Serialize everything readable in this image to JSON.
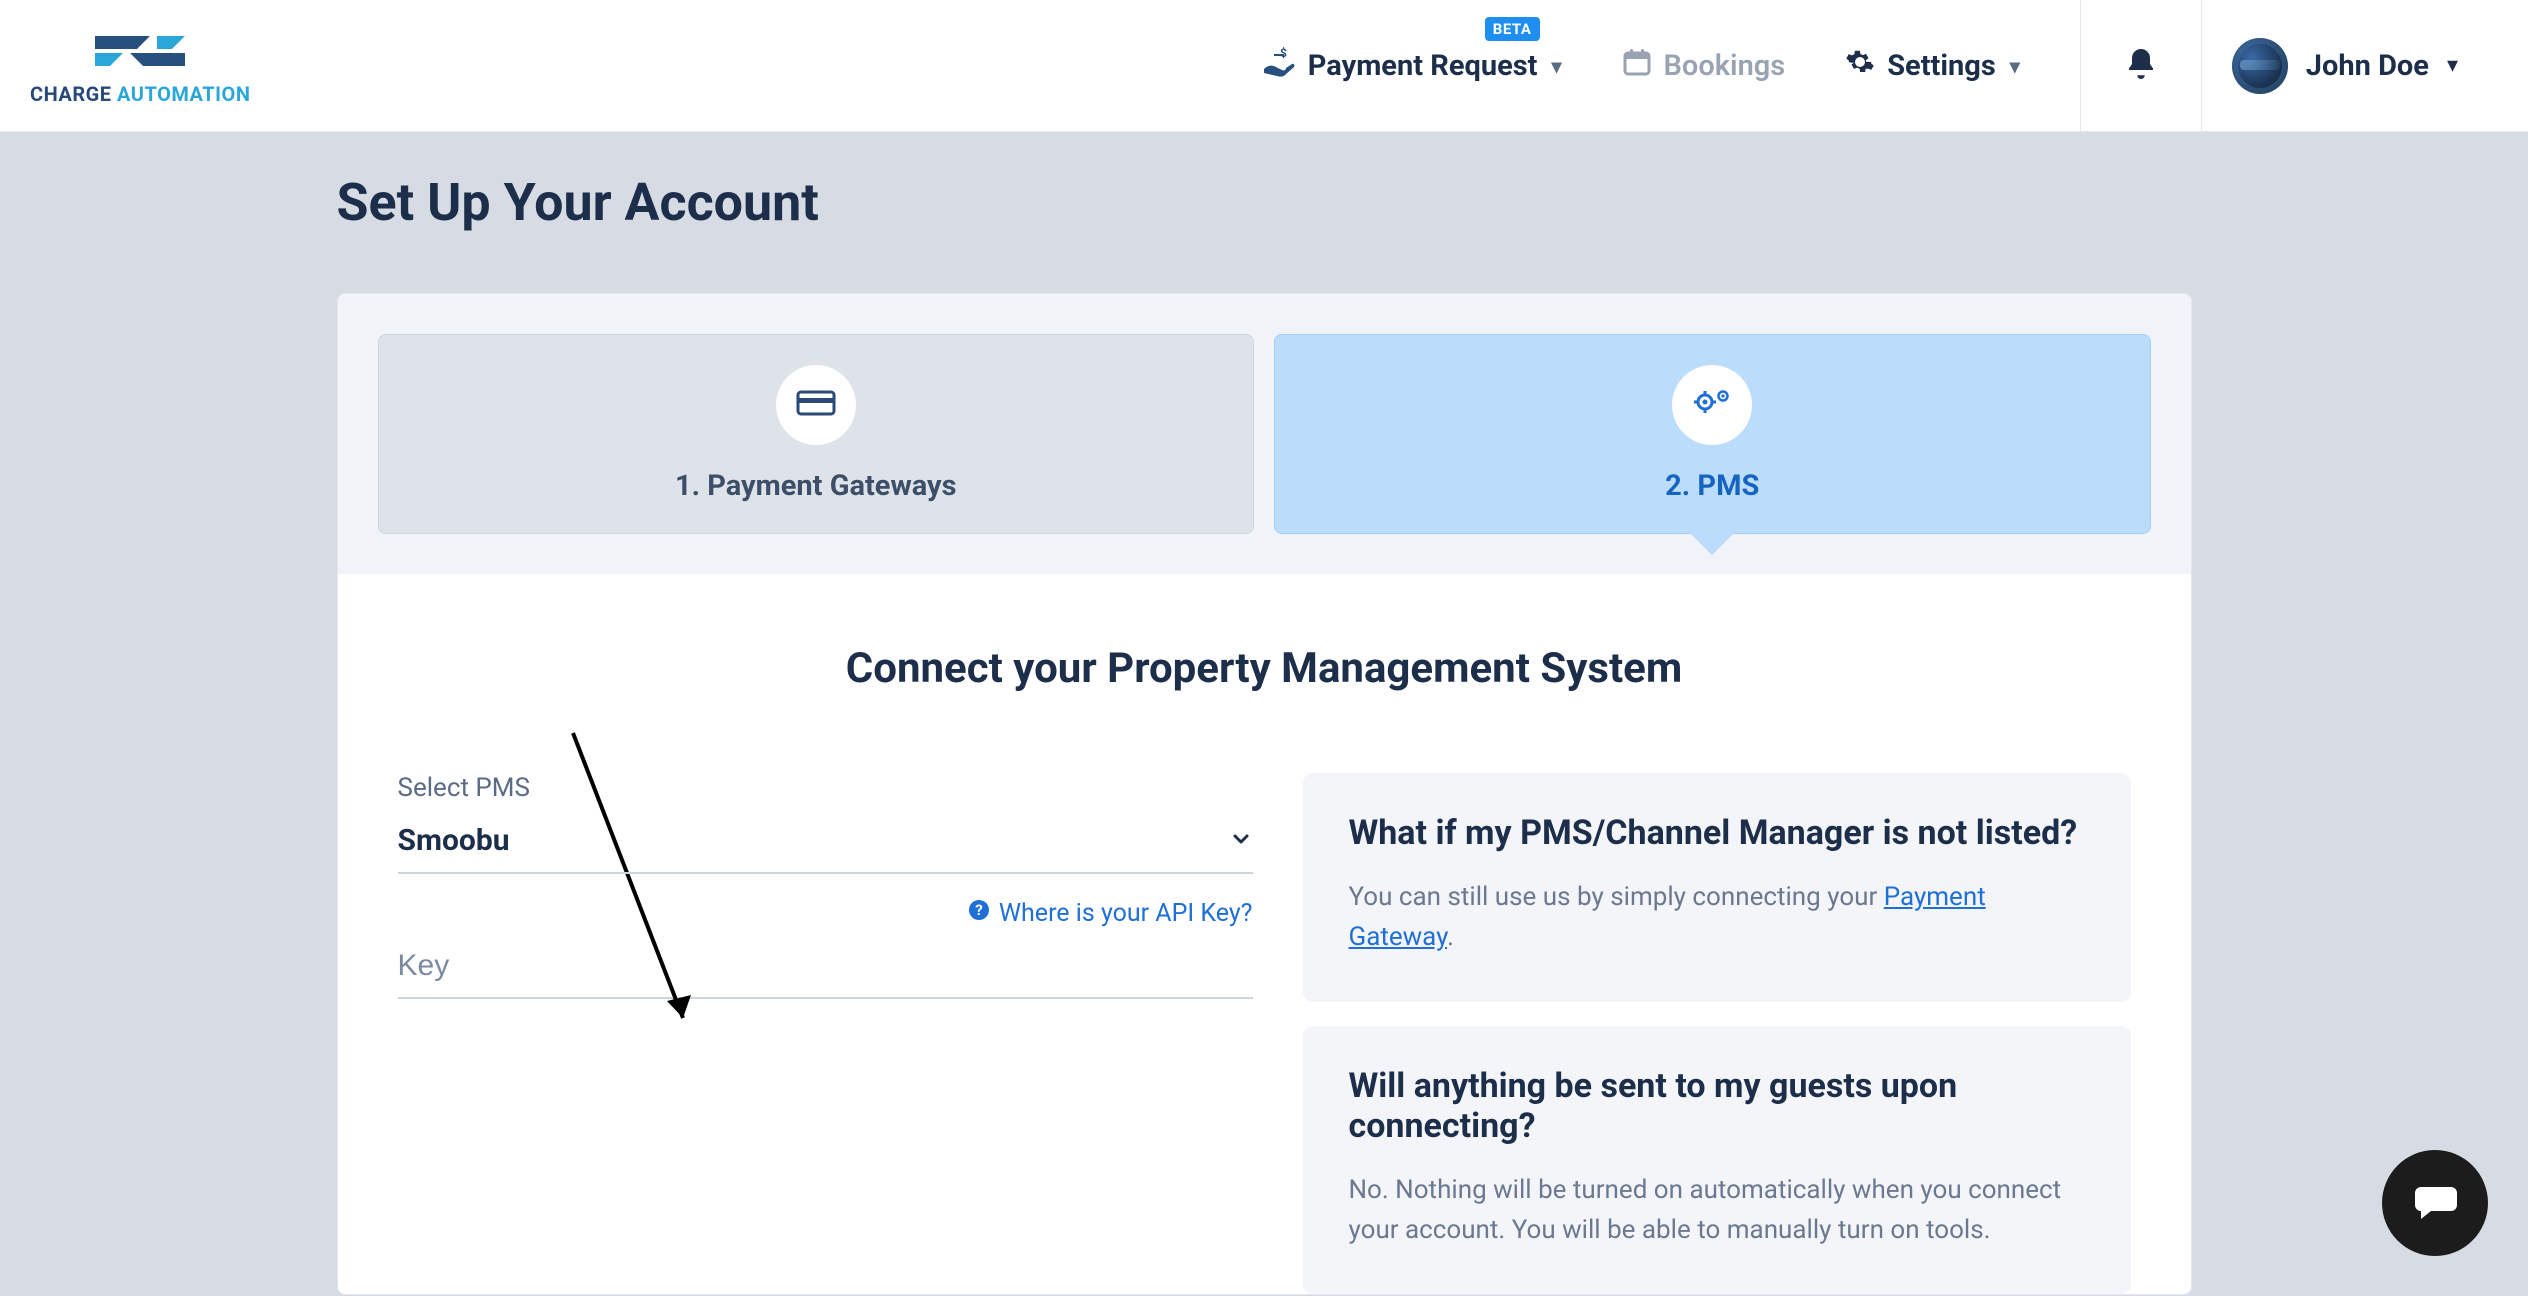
{
  "header": {
    "logo_text_primary": "CHARGE ",
    "logo_text_accent": "AUTOMATION",
    "nav": {
      "payment_request": "Payment Request",
      "payment_request_badge": "BETA",
      "bookings": "Bookings",
      "settings": "Settings"
    },
    "user_name": "John Doe"
  },
  "page": {
    "title": "Set Up Your Account",
    "tabs": {
      "payment_gateways": "1. Payment Gateways",
      "pms": "2. PMS"
    },
    "panel": {
      "title": "Connect your Property Management System",
      "select_label": "Select PMS",
      "select_value": "Smoobu",
      "api_link_text": "Where is your API Key?",
      "key_placeholder": "Key"
    },
    "faq": [
      {
        "q": "What if my PMS/Channel Manager is not listed?",
        "a_prefix": "You can still use us by simply connecting your ",
        "a_link": "Payment Gateway",
        "a_suffix": "."
      },
      {
        "q": "Will anything be sent to my guests upon connecting?",
        "a": "No. Nothing will be turned on automatically when you connect your account. You will be able to manually turn on tools."
      }
    ]
  }
}
